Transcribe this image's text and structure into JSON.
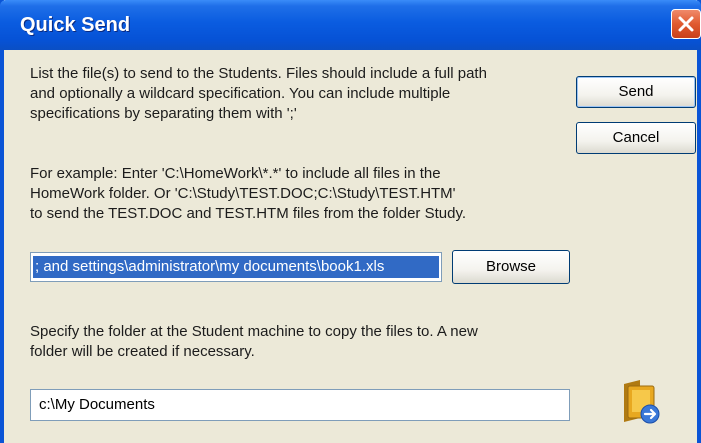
{
  "window": {
    "title": "Quick Send"
  },
  "instructions": "List the file(s) to send to the Students. Files should include a full path\nand optionally a wildcard specification. You can include multiple\nspecifications by separating them with ';'",
  "example": "For example: Enter 'C:\\HomeWork\\*.*' to include all files in the\nHomeWork folder. Or 'C:\\Study\\TEST.DOC;C:\\Study\\TEST.HTM'\nto send the TEST.DOC and TEST.HTM files from the folder Study.",
  "buttons": {
    "send": "Send",
    "cancel": "Cancel",
    "browse": "Browse"
  },
  "file_input": {
    "value": "; and settings\\administrator\\my documents\\book1.xls"
  },
  "destination": {
    "label": "Specify the folder at the Student machine to copy the files to. A new\nfolder will be created if necessary.",
    "value": "c:\\My Documents"
  },
  "icons": {
    "close": "close-icon",
    "folder": "folder-send-icon"
  },
  "colors": {
    "titlebar": "#0a5ce0",
    "close": "#e05a30",
    "selection": "#316ac5",
    "dialog_bg": "#ece9d8"
  }
}
